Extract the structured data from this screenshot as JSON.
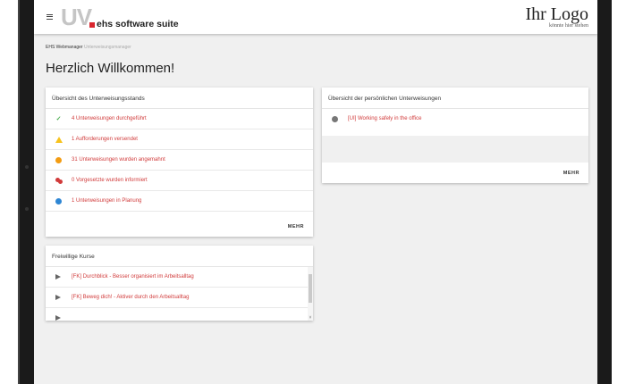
{
  "topbar": {
    "logo_uv": "UV",
    "logo_suite": "ehs software suite",
    "ihr_logo_title": "Ihr Logo",
    "ihr_logo_sub": "könnte hier stehen"
  },
  "breadcrumb": {
    "root": "EHS Webmanager",
    "current": "Unterweisungsmanager"
  },
  "page_title": "Herzlich Willkommen!",
  "status_card": {
    "title": "Übersicht des Unterweisungsstands",
    "items": [
      {
        "icon": "check-icon",
        "label": "4 Unterweisungen durchgeführt"
      },
      {
        "icon": "warning-icon",
        "label": "1 Aufforderungen versendet"
      },
      {
        "icon": "alert-icon",
        "label": "31 Unterweisungen wurden angemahnt"
      },
      {
        "icon": "people-icon",
        "label": "0 Vorgesetzte wurden informiert"
      },
      {
        "icon": "clock-icon",
        "label": "1 Unterweisungen in Planung"
      }
    ],
    "more": "MEHR"
  },
  "personal_card": {
    "title": "Übersicht der persönlichen Unterweisungen",
    "items": [
      {
        "icon": "info-icon",
        "label": "[UI] Working safely in the office"
      }
    ],
    "more": "MEHR"
  },
  "courses_card": {
    "title": "Freiwillige Kurse",
    "items": [
      {
        "icon": "play-icon",
        "label": "[FK] Durchblick - Besser organisiert im Arbeitsalltag"
      },
      {
        "icon": "play-icon",
        "label": "[FK] Beweg dich! - Aktiver durch den Arbeitsalltag"
      }
    ],
    "scroll_down": "˅"
  },
  "colors": {
    "link_red": "#d13b3b",
    "brand_red": "#d9262e",
    "check_green": "#4caf50",
    "warning_yellow": "#f7c21c",
    "alert_orange": "#f39c12",
    "planning_blue": "#2e86d4"
  }
}
